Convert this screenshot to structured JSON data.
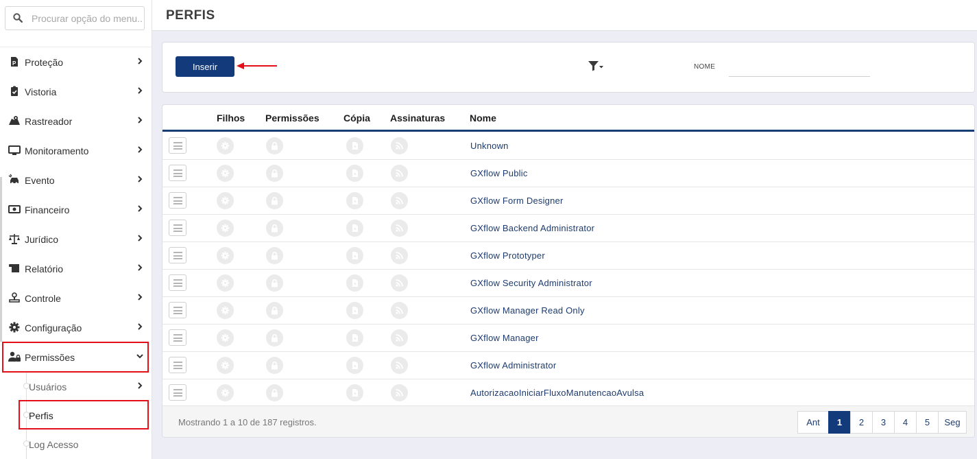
{
  "sidebar": {
    "search": {
      "placeholder": "Procurar opção do menu..."
    },
    "items": [
      {
        "label": "Proteção",
        "icon": "document-p-icon"
      },
      {
        "label": "Vistoria",
        "icon": "clipboard-check-icon"
      },
      {
        "label": "Rastreador",
        "icon": "map-marker-icon"
      },
      {
        "label": "Monitoramento",
        "icon": "monitor-icon"
      },
      {
        "label": "Evento",
        "icon": "car-crash-icon"
      },
      {
        "label": "Financeiro",
        "icon": "money-bill-icon"
      },
      {
        "label": "Jurídico",
        "icon": "balance-scale-icon"
      },
      {
        "label": "Relatório",
        "icon": "scroll-icon"
      },
      {
        "label": "Controle",
        "icon": "stamp-icon"
      },
      {
        "label": "Configuração",
        "icon": "gear-icon"
      },
      {
        "label": "Permissões",
        "icon": "user-lock-icon"
      }
    ],
    "subitems": [
      {
        "label": "Usuários"
      },
      {
        "label": "Perfis"
      },
      {
        "label": "Log Acesso"
      }
    ]
  },
  "header": {
    "title": "PERFIS"
  },
  "filter": {
    "insert_label": "Inserir",
    "nome_label": "NOME",
    "nome_value": ""
  },
  "table": {
    "columns": [
      "Filhos",
      "Permissões",
      "Cópia",
      "Assinaturas",
      "Nome"
    ],
    "rows": [
      "Unknown",
      "GXflow Public",
      "GXflow Form Designer",
      "GXflow Backend Administrator",
      "GXflow Prototyper",
      "GXflow Security Administrator",
      "GXflow Manager Read Only",
      "GXflow Manager",
      "GXflow Administrator",
      "AutorizacaoIniciarFluxoManutencaoAvulsa"
    ],
    "footer_info": "Mostrando 1 a 10 de 187 registros."
  },
  "pagination": {
    "prev": "Ant",
    "pages": [
      "1",
      "2",
      "3",
      "4",
      "5"
    ],
    "next": "Seg",
    "current": "1"
  },
  "colors": {
    "primary": "#133b7b",
    "highlight": "#e3101a",
    "link": "#1d3b6e"
  }
}
